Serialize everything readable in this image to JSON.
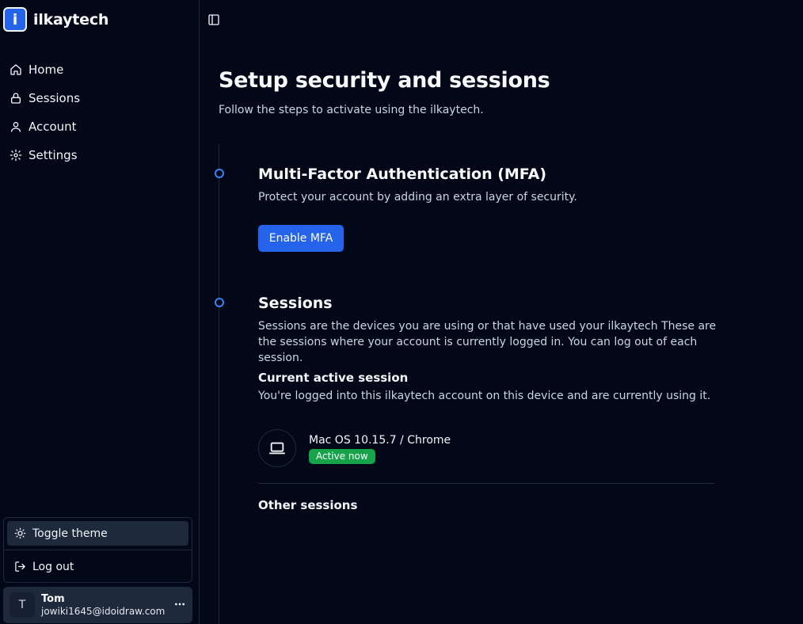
{
  "brand": {
    "logo_letter": "i",
    "name": "ilkaytech",
    "accent": "#2563eb"
  },
  "nav": {
    "items": [
      {
        "label": "Home",
        "icon": "home-icon"
      },
      {
        "label": "Sessions",
        "icon": "lock-icon"
      },
      {
        "label": "Account",
        "icon": "user-icon"
      },
      {
        "label": "Settings",
        "icon": "gear-icon"
      }
    ]
  },
  "menu": {
    "toggle_theme": "Toggle theme",
    "log_out": "Log out"
  },
  "user": {
    "initial": "T",
    "name": "Tom",
    "email": "jowiki1645@idoidraw.com"
  },
  "page": {
    "title": "Setup security and sessions",
    "subtitle": "Follow the steps to activate using the ilkaytech."
  },
  "mfa": {
    "title": "Multi-Factor Authentication (MFA)",
    "description": "Protect your account by adding an extra layer of security.",
    "button": "Enable MFA"
  },
  "sessions": {
    "title": "Sessions",
    "description": "Sessions are the devices you are using or that have used your ilkaytech These are the sessions where your account is currently logged in. You can log out of each session.",
    "current_title": "Current active session",
    "current_description": "You're logged into this ilkaytech account on this device and are currently using it.",
    "device": "Mac OS 10.15.7 / Chrome",
    "status": "Active now",
    "status_color": "#16a34a",
    "other_title": "Other sessions"
  }
}
